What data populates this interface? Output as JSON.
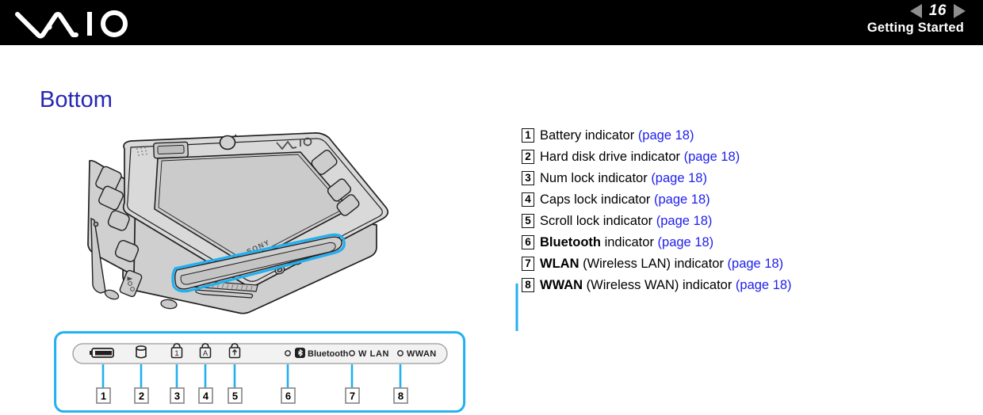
{
  "header": {
    "logo_name": "vaio-logo",
    "page_number": "16",
    "prev_arrow": "prev-page-arrow",
    "next_arrow": "next-page-arrow",
    "section": "Getting Started"
  },
  "heading": "Bottom",
  "illustration": {
    "device_label": "SONY",
    "device_logo": "VAIO",
    "alt": "vaio-ux-micro-pc-bottom-view"
  },
  "callout": {
    "indicators": [
      {
        "num": "1",
        "icon": "battery-icon",
        "label": ""
      },
      {
        "num": "2",
        "icon": "harddisk-icon",
        "label": ""
      },
      {
        "num": "3",
        "icon": "numlock-icon",
        "label": ""
      },
      {
        "num": "4",
        "icon": "capslock-icon",
        "label": ""
      },
      {
        "num": "5",
        "icon": "scrolllock-icon",
        "label": ""
      },
      {
        "num": "6",
        "icon": "bluetooth-icon",
        "label": "Bluetooth"
      },
      {
        "num": "7",
        "icon": "wlan-icon",
        "label": "W LAN"
      },
      {
        "num": "8",
        "icon": "wwan-icon",
        "label": "WWAN"
      }
    ]
  },
  "list": [
    {
      "num": "1",
      "bold": "",
      "text": "Battery indicator ",
      "link": "(page 18)"
    },
    {
      "num": "2",
      "bold": "",
      "text": "Hard disk drive indicator ",
      "link": "(page 18)"
    },
    {
      "num": "3",
      "bold": "",
      "text": "Num lock indicator ",
      "link": "(page 18)"
    },
    {
      "num": "4",
      "bold": "",
      "text": "Caps lock indicator ",
      "link": "(page 18)"
    },
    {
      "num": "5",
      "bold": "",
      "text": "Scroll lock indicator ",
      "link": "(page 18)"
    },
    {
      "num": "6",
      "bold": "Bluetooth",
      "text": " indicator ",
      "link": "(page 18)"
    },
    {
      "num": "7",
      "bold": "WLAN",
      "text": " (Wireless LAN) indicator ",
      "link": "(page 18)"
    },
    {
      "num": "8",
      "bold": "WWAN",
      "text": " (Wireless WAN) indicator ",
      "link": "(page 18)"
    }
  ],
  "colors": {
    "header_bg": "#000000",
    "heading_blue": "#2526b5",
    "link_blue": "#2020ee",
    "highlight_cyan": "#22b0f0",
    "device_body": "#d4d4d4",
    "arrow_grey": "#8f8f8f"
  }
}
